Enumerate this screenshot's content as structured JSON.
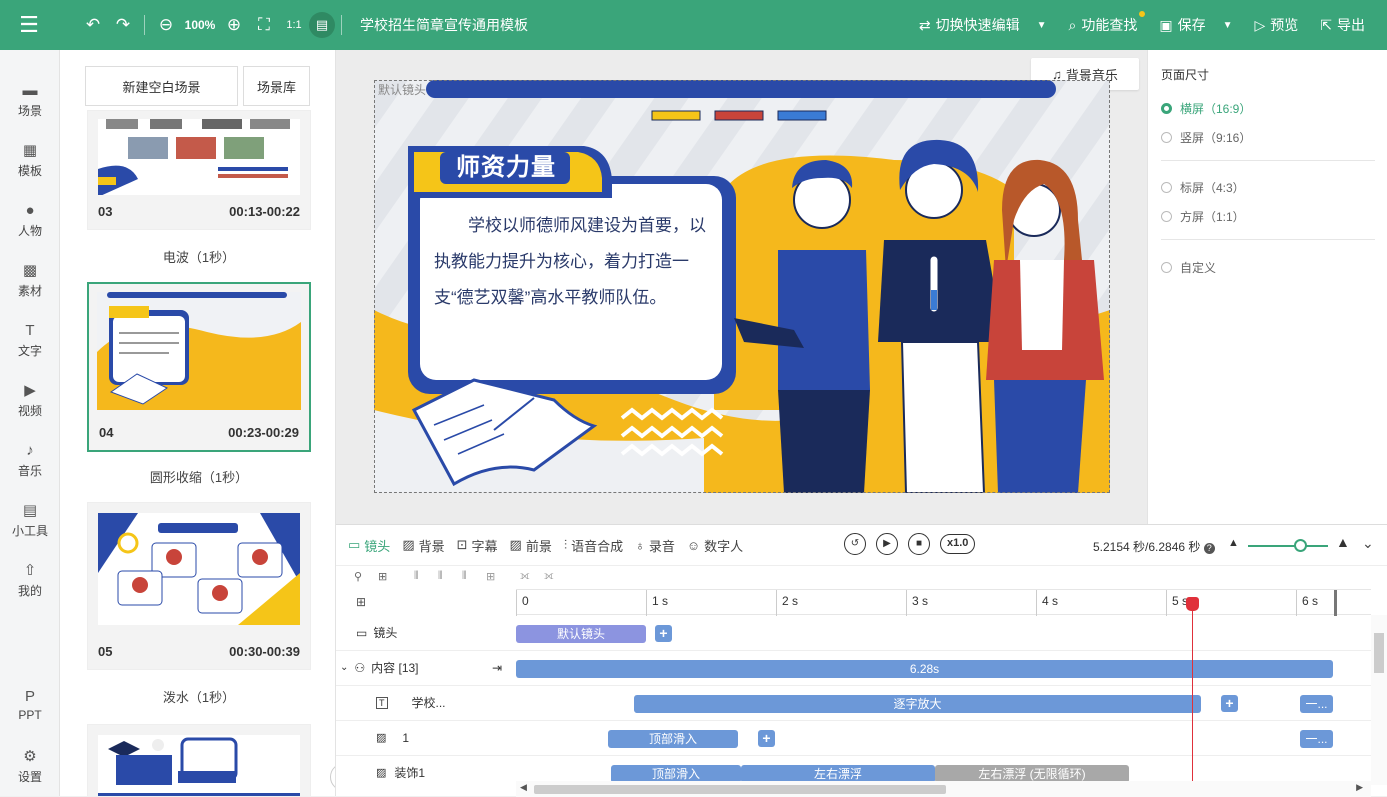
{
  "topbar": {
    "zoom": "100%",
    "doc_title": "学校招生简章宣传通用模板",
    "switch_edit": "切换快速编辑",
    "find": "功能查找",
    "save": "保存",
    "preview": "预览",
    "export": "导出"
  },
  "nav": [
    "场景",
    "模板",
    "人物",
    "素材",
    "文字",
    "视频",
    "音乐",
    "小工具",
    "我的",
    "PPT",
    "设置"
  ],
  "scenes": {
    "new_blank": "新建空白场景",
    "library": "场景库",
    "cards": [
      {
        "num": "03",
        "time": "00:13-00:22",
        "transition": "电波（1秒）"
      },
      {
        "num": "04",
        "time": "00:23-00:29",
        "transition": "圆形收缩（1秒）"
      },
      {
        "num": "05",
        "time": "00:30-00:39",
        "transition": "泼水（1秒）"
      }
    ]
  },
  "canvas": {
    "default_lens": "默认镜头",
    "bgm": "背景音乐",
    "heading": "师资力量",
    "body": "学校以师德师风建设为首要，以执教能力提升为核心，着力打造一支“德艺双馨”高水平教师队伍。"
  },
  "right_panel": {
    "title": "页面尺寸",
    "options": [
      "横屏（16:9）",
      "竖屏（9:16）",
      "标屏（4:3）",
      "方屏（1:1）",
      "自定义"
    ],
    "selected": "横屏（16:9）"
  },
  "timeline": {
    "tabs": [
      "镜头",
      "背景",
      "字幕",
      "前景",
      "语音合成",
      "录音",
      "数字人"
    ],
    "speed": "x1.0",
    "time_display": "5.2154 秒/6.2846 秒",
    "ticks": [
      "0",
      "1 s",
      "2 s",
      "3 s",
      "4 s",
      "5 s",
      "6 s"
    ],
    "playhead_seconds": 5.2154,
    "rows": [
      {
        "label": "镜头",
        "bars": [
          {
            "text": "默认镜头",
            "color": "purple"
          }
        ]
      },
      {
        "label": "内容 [13]",
        "bars": [
          {
            "text": "6.28s",
            "color": "blue"
          }
        ]
      },
      {
        "label": "学校...",
        "bars": [
          {
            "text": "逐字放大",
            "color": "blue"
          },
          {
            "text": "一...",
            "color": "blue"
          }
        ]
      },
      {
        "label": "1",
        "bars": [
          {
            "text": "顶部滑入",
            "color": "blue"
          },
          {
            "text": "一...",
            "color": "blue"
          }
        ]
      },
      {
        "label": "装饰1",
        "bars": [
          {
            "text": "顶部滑入",
            "color": "blue"
          },
          {
            "text": "左右漂浮",
            "color": "blue"
          },
          {
            "text": "左右漂浮 (无限循环)",
            "color": "gray"
          }
        ]
      }
    ]
  },
  "colors": {
    "accent": "#3aa57a",
    "bar_blue": "#6c98d8",
    "bar_purple": "#8c94e0",
    "playhead": "#e0303a"
  }
}
